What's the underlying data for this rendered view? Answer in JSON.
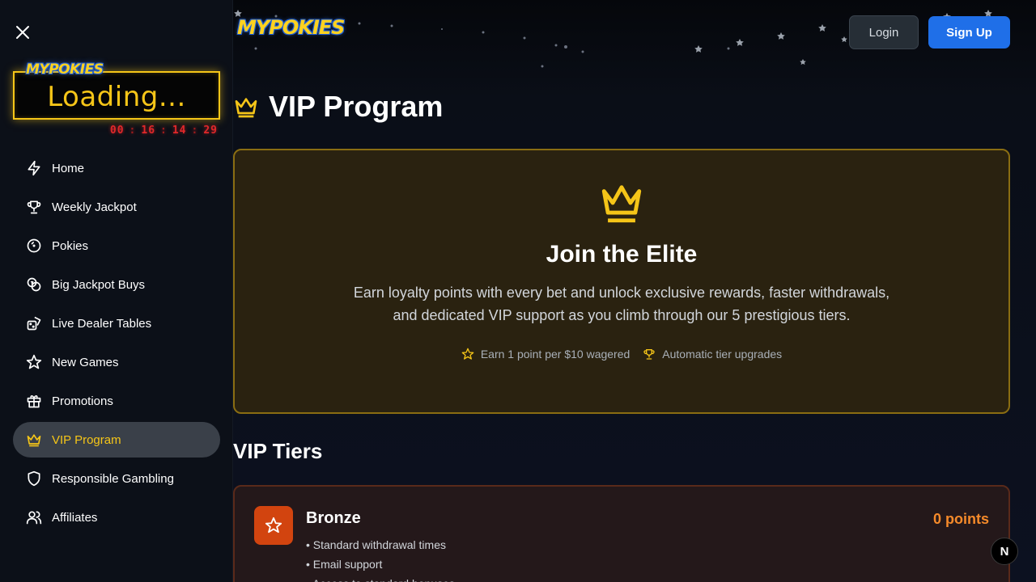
{
  "brand": {
    "logo_text": "MYPOKIES"
  },
  "sidebar": {
    "jackpot": {
      "logo_text": "MYPOKIES",
      "loading_text": "Loading...",
      "timer": [
        "00",
        "16",
        "14",
        "29"
      ]
    },
    "items": [
      {
        "label": "Home",
        "icon": "lightning-icon"
      },
      {
        "label": "Weekly Jackpot",
        "icon": "trophy-icon"
      },
      {
        "label": "Pokies",
        "icon": "pokies-icon"
      },
      {
        "label": "Big Jackpot Buys",
        "icon": "coins-icon"
      },
      {
        "label": "Live Dealer Tables",
        "icon": "dice-icon"
      },
      {
        "label": "New Games",
        "icon": "star-icon"
      },
      {
        "label": "Promotions",
        "icon": "gift-icon"
      },
      {
        "label": "VIP Program",
        "icon": "crown-icon",
        "active": true
      },
      {
        "label": "Responsible Gambling",
        "icon": "shield-icon"
      },
      {
        "label": "Affiliates",
        "icon": "users-icon"
      }
    ]
  },
  "header": {
    "login_label": "Login",
    "signup_label": "Sign Up"
  },
  "page": {
    "title": "VIP Program",
    "elite": {
      "title": "Join the Elite",
      "description": "Earn loyalty points with every bet and unlock exclusive rewards, faster withdrawals, and dedicated VIP support as you climb through our 5 prestigious tiers.",
      "features": [
        "Earn 1 point per $10 wagered",
        "Automatic tier upgrades"
      ]
    },
    "tiers_title": "VIP Tiers",
    "tiers": [
      {
        "name": "Bronze",
        "points": "0 points",
        "benefits": [
          "• Standard withdrawal times",
          "• Email support",
          "• Access to standard bonuses"
        ]
      }
    ]
  },
  "badge": {
    "letter": "N"
  },
  "colors": {
    "accent": "#f5c518",
    "primary": "#1f6fe8",
    "bronze": "#d2440f",
    "timer": "#e0282a"
  }
}
